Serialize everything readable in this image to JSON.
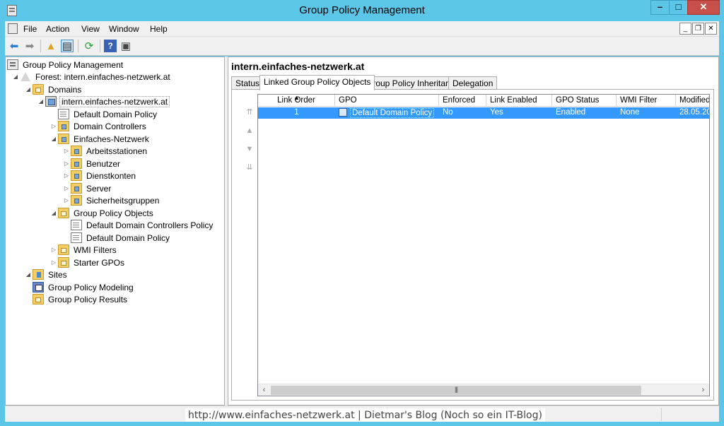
{
  "window": {
    "title": "Group Policy Management",
    "controls": {
      "minimize": "–",
      "maximize": "□",
      "close": "✕"
    }
  },
  "menu": {
    "items": [
      "File",
      "Action",
      "View",
      "Window",
      "Help"
    ],
    "mdi_controls": {
      "minimize": "_",
      "restore": "❐",
      "close": "✕"
    }
  },
  "toolbar": {
    "buttons": [
      {
        "name": "back-icon",
        "glyph": "⬅"
      },
      {
        "name": "forward-icon",
        "glyph": "➡"
      },
      {
        "name": "up-level-icon",
        "glyph": "▲"
      },
      {
        "name": "show-hide-tree-icon",
        "glyph": "▤"
      },
      {
        "name": "refresh-icon",
        "glyph": "⟳"
      },
      {
        "name": "help-icon",
        "glyph": "?"
      },
      {
        "name": "show-action-pane-icon",
        "glyph": "▣"
      }
    ]
  },
  "tree": {
    "root": "Group Policy Management",
    "forest": "Forest: intern.einfaches-netzwerk.at",
    "domains": "Domains",
    "domain": "intern.einfaches-netzwerk.at",
    "default_domain_policy": "Default Domain Policy",
    "domain_controllers": "Domain Controllers",
    "einfaches_netzwerk": "Einfaches-Netzwerk",
    "ou_children": [
      "Arbeitsstationen",
      "Benutzer",
      "Dienstkonten",
      "Server",
      "Sicherheitsgruppen"
    ],
    "gpo_container": "Group Policy Objects",
    "gpos": [
      "Default Domain Controllers Policy",
      "Default Domain Policy"
    ],
    "wmi_filters": "WMI Filters",
    "starter_gpos": "Starter GPOs",
    "sites": "Sites",
    "modeling": "Group Policy Modeling",
    "results": "Group Policy Results"
  },
  "right": {
    "title": "intern.einfaches-netzwerk.at",
    "tabs": [
      "Status",
      "Linked Group Policy Objects",
      "Group Policy Inheritance",
      "Delegation"
    ],
    "active_tab": 1,
    "columns": [
      "Link Order",
      "GPO",
      "Enforced",
      "Link Enabled",
      "GPO Status",
      "WMI Filter",
      "Modified"
    ],
    "rows": [
      [
        "1",
        "Default Domain Policy",
        "No",
        "Yes",
        "Enabled",
        "None",
        "28.05.20"
      ]
    ],
    "order_buttons": [
      "⇈",
      "▲",
      "▼",
      "⇊"
    ]
  },
  "watermark": "http://www.einfaches-netzwerk.at | Dietmar's Blog (Noch so ein IT-Blog)",
  "colors": {
    "titlebar": "#5cc6e8",
    "selection": "#3399ff",
    "close": "#c7504b"
  }
}
